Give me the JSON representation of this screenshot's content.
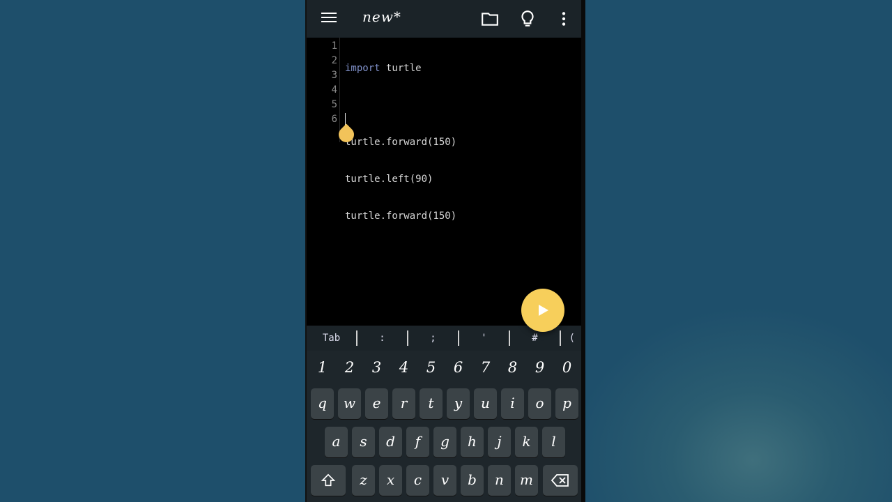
{
  "app": {
    "title": "new*",
    "icons": [
      "menu-icon",
      "folder-icon",
      "lightbulb-icon",
      "more-vert-icon"
    ]
  },
  "editor": {
    "line_numbers": [
      "1",
      "2",
      "3",
      "4",
      "5",
      "6"
    ],
    "lines": {
      "l1_keyword": "import",
      "l1_rest": " turtle",
      "l2": "",
      "l3": "turtle.forward(150)",
      "l4": "turtle.left(90)",
      "l5": "turtle.forward(150)",
      "l6": ""
    }
  },
  "run_button": {
    "icon": "play-icon"
  },
  "symbol_bar": {
    "tab": "Tab",
    "colon": ":",
    "semicolon": ";",
    "quote": "'",
    "hash": "#",
    "paren": "("
  },
  "keyboard": {
    "numbers": [
      "1",
      "2",
      "3",
      "4",
      "5",
      "6",
      "7",
      "8",
      "9",
      "0"
    ],
    "row1": [
      "q",
      "w",
      "e",
      "r",
      "t",
      "y",
      "u",
      "i",
      "o",
      "p"
    ],
    "row2": [
      "a",
      "s",
      "d",
      "f",
      "g",
      "h",
      "j",
      "k",
      "l"
    ],
    "row3": [
      "z",
      "x",
      "c",
      "v",
      "b",
      "n",
      "m"
    ],
    "shift_icon": "shift-icon",
    "backspace_icon": "backspace-icon"
  },
  "colors": {
    "accent": "#f7cf5b",
    "appbar": "#1b2328",
    "keyword": "#7f8fc8",
    "background": "#1e4f6b"
  }
}
